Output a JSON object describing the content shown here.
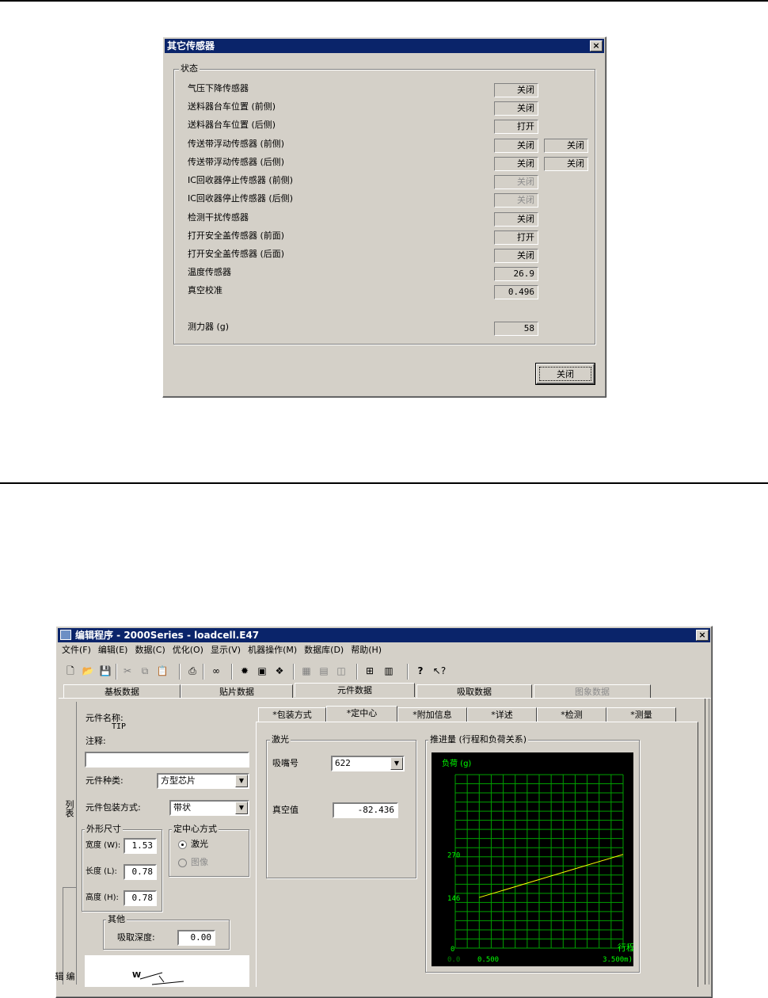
{
  "dialog": {
    "title": "其它传感器",
    "close_x": "×",
    "status_group": "状态",
    "rows": [
      {
        "label": "气压下降传感器",
        "value": "关闭",
        "enabled": true
      },
      {
        "label": "送料器台车位置 (前侧)",
        "value": "关闭",
        "enabled": true
      },
      {
        "label": "送料器台车位置 (后侧)",
        "value": "打开",
        "enabled": true
      },
      {
        "label": "传送带浮动传感器 (前侧)",
        "value": "关闭",
        "value2": "关闭",
        "enabled": true
      },
      {
        "label": "传送带浮动传感器 (后侧)",
        "value": "关闭",
        "value2": "关闭",
        "enabled": true
      },
      {
        "label": "IC回收器停止传感器 (前侧)",
        "value": "关闭",
        "enabled": false
      },
      {
        "label": "IC回收器停止传感器 (后侧)",
        "value": "关闭",
        "enabled": false
      },
      {
        "label": "检测干扰传感器",
        "value": "关闭",
        "enabled": true
      },
      {
        "label": "打开安全盖传感器 (前面)",
        "value": "打开",
        "enabled": true
      },
      {
        "label": "打开安全盖传感器 (后面)",
        "value": "关闭",
        "enabled": true
      },
      {
        "label": "温度传感器",
        "value": "26.9",
        "enabled": true
      },
      {
        "label": "真空校准",
        "value": "0.496",
        "enabled": true
      }
    ],
    "loadcell_label": "测力器 (g)",
    "loadcell_value": "58",
    "close_button": "关闭"
  },
  "editor": {
    "title": "编辑程序 - 2000Series - loadcell.E47",
    "close_x": "×",
    "menu": [
      "文件(F)",
      "编辑(E)",
      "数据(C)",
      "优化(O)",
      "显示(V)",
      "机器操作(M)",
      "数据库(D)",
      "帮助(H)"
    ],
    "toolbar_icons": [
      "new-icon",
      "open-icon",
      "save-icon",
      "cut-icon",
      "copy-icon",
      "paste-icon",
      "print-icon",
      "find-icon",
      "light-icon",
      "component-icon",
      "group-icon",
      "grid-icon",
      "feeder-icon",
      "tray-icon",
      "center-icon",
      "bar-icon",
      "help-icon",
      "context-help-icon"
    ],
    "main_tabs": [
      {
        "label": "基板数据",
        "state": "normal"
      },
      {
        "label": "贴片数据",
        "state": "normal"
      },
      {
        "label": "元件数据",
        "state": "selected"
      },
      {
        "label": "吸取数据",
        "state": "normal"
      },
      {
        "label": "图象数据",
        "state": "disabled"
      }
    ],
    "side_tabs": [
      "列表",
      "编辑"
    ],
    "component_name_label": "元件名称:",
    "component_name_value": "TIP",
    "comment_label": "注释:",
    "comment_value": "",
    "component_type_label": "元件种类:",
    "component_type_value": "方型芯片",
    "package_label": "元件包装方式:",
    "package_value": "带状",
    "dimensions_group": "外形尺寸",
    "width_label": "宽度 (W):",
    "width_value": "1.53",
    "length_label": "长度 (L):",
    "length_value": "0.78",
    "height_label": "高度 (H):",
    "height_value": "0.78",
    "centering_group": "定中心方式",
    "centering_laser": "激光",
    "centering_image": "图像",
    "other_group": "其他",
    "pick_depth_label": "吸取深度:",
    "pick_depth_value": "0.00",
    "diagram_label": "W",
    "sub_tabs": [
      {
        "label": "*包装方式",
        "selected": false
      },
      {
        "label": "*定中心",
        "selected": true
      },
      {
        "label": "*附加信息",
        "selected": false
      },
      {
        "label": "*详述",
        "selected": false
      },
      {
        "label": "*检测",
        "selected": false
      },
      {
        "label": "*测量",
        "selected": false
      }
    ],
    "laser_group": "激光",
    "nozzle_label": "吸嘴号",
    "nozzle_value": "622",
    "vacuum_label": "真空值",
    "vacuum_value": "-82.436",
    "push_group": "推进量 (行程和负荷关系)"
  },
  "chart_data": {
    "type": "line",
    "ylabel": "负荷 (g)",
    "xlabel": "行程",
    "y_ticks": [
      "270",
      "146",
      "0"
    ],
    "x_ticks": [
      "0.0",
      "0.500",
      "3.500m)"
    ],
    "series": [
      {
        "x": [
          0.5,
          3.5
        ],
        "y": [
          146,
          270
        ]
      }
    ],
    "xlim": [
      0,
      3.5
    ],
    "ylim": [
      0,
      500
    ],
    "grid": true,
    "colors": {
      "background": "#000000",
      "grid": "#00a000",
      "line": "#ffff00",
      "text": "#00ff00"
    }
  }
}
